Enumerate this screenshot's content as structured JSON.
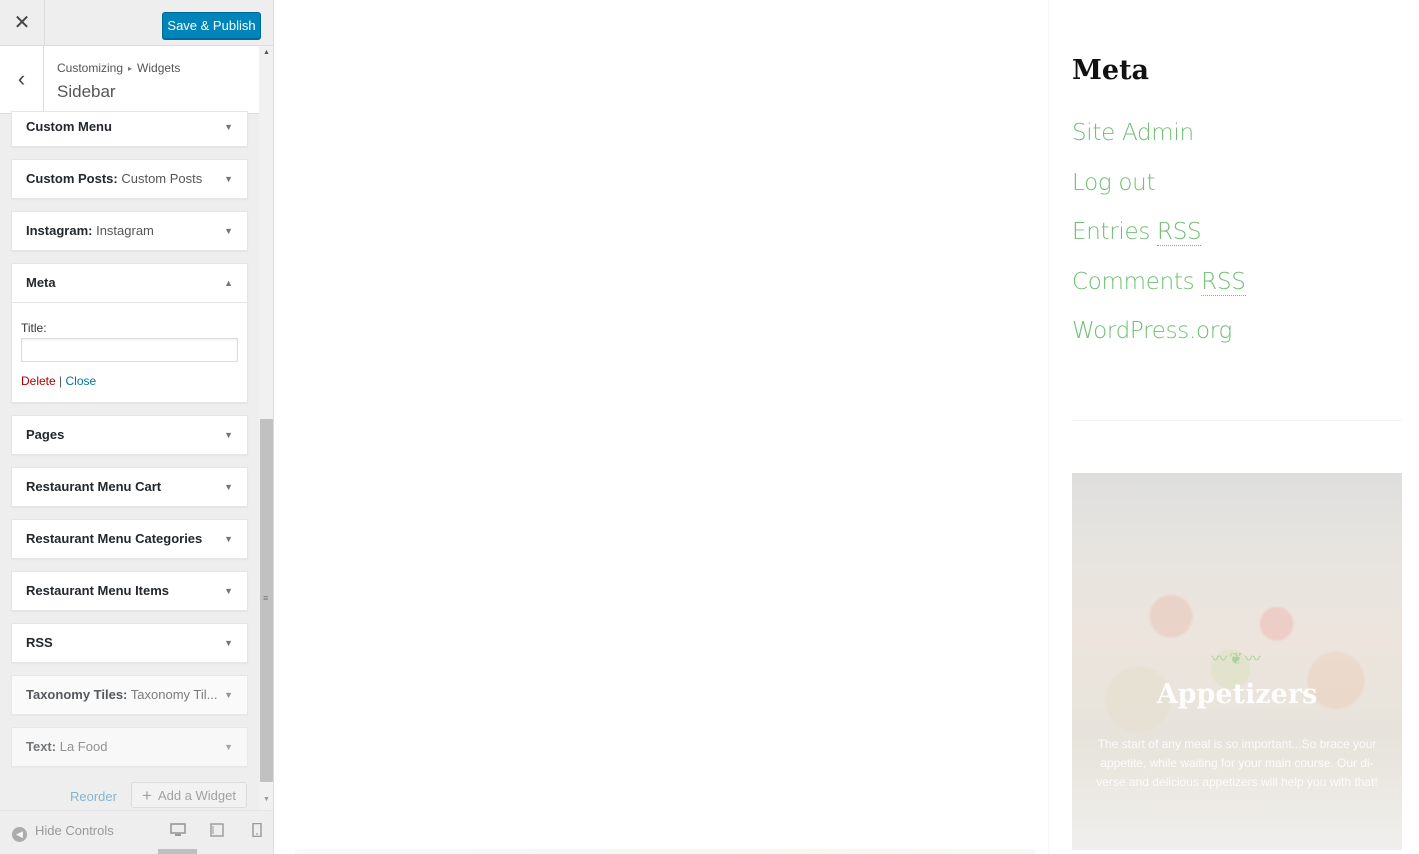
{
  "topbar": {
    "close_glyph": "✕",
    "publish_label": "Save & Publish"
  },
  "header": {
    "crumb_1": "Customizing",
    "crumb_sep": "▸",
    "crumb_2": "Widgets",
    "title": "Sidebar",
    "back_glyph": "‹"
  },
  "widgets": [
    {
      "label": "Custom Menu",
      "sub": ""
    },
    {
      "label": "Custom Posts:",
      "sub": " Custom Posts"
    },
    {
      "label": "Instagram:",
      "sub": " Instagram"
    },
    {
      "label": "Meta",
      "sub": ""
    },
    {
      "label": "Pages",
      "sub": ""
    },
    {
      "label": "Restaurant Menu Cart",
      "sub": ""
    },
    {
      "label": "Restaurant Menu Categories",
      "sub": ""
    },
    {
      "label": "Restaurant Menu Items",
      "sub": ""
    },
    {
      "label": "RSS",
      "sub": ""
    },
    {
      "label": "Taxonomy Tiles:",
      "sub": " Taxonomy Til..."
    },
    {
      "label": "Text:",
      "sub": " La Food"
    }
  ],
  "meta_widget_form": {
    "title_label": "Title:",
    "title_value": "",
    "delete_label": "Delete",
    "divider": "|",
    "close_label": "Close"
  },
  "bottom_actions": {
    "reorder_label": "Reorder",
    "add_widget_label": "Add a Widget"
  },
  "footer": {
    "hide_controls_label": "Hide Controls",
    "device_selected": "desktop"
  },
  "preview": {
    "meta_heading": "Meta",
    "links": [
      {
        "text": "Site Admin",
        "abbr": ""
      },
      {
        "text": "Log out",
        "abbr": ""
      },
      {
        "text": "Entries ",
        "abbr": "RSS"
      },
      {
        "text": "Comments ",
        "abbr": "RSS"
      },
      {
        "text": "WordPress.org",
        "abbr": ""
      }
    ],
    "tile": {
      "title": "Appetizers",
      "description": "The start of any meal is so important...So brace your appetite, while waiting for your main course. Our di-verse and delicious appetizers will help you with that!"
    }
  },
  "colors": {
    "accent": "#0085ba",
    "link_green": "#6fbe73",
    "delete_red": "#a00",
    "link_blue": "#0073aa"
  }
}
